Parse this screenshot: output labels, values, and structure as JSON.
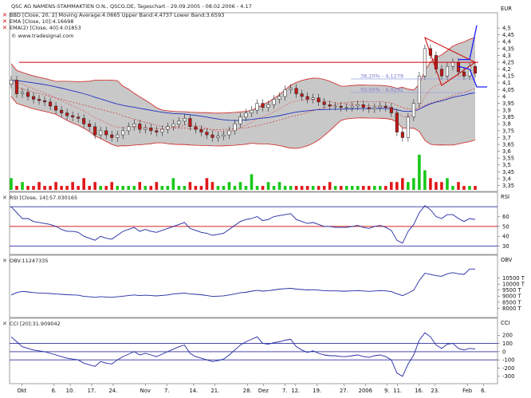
{
  "chart_data": {
    "type": "line",
    "header": "QSC AG NAMENS-STAMMAKTIEN O.N., QSCG.DE, Tageschart - 29.09.2005 - 08.02.2006 - 4.17",
    "currency": "EUR",
    "legend": [
      "BBD [Close, 20, 2] Moving Average:4.0665 Upper Band:4.4737 Lower Band:3.6593",
      "EMA [Close, 10]:4.16698",
      "EMA(2) [Close, 40]:4.01853"
    ],
    "source": "© www.tradesignal.com",
    "x_ticks": [
      "Okt",
      "6.",
      "10.",
      "17.",
      "24.",
      "Nov",
      "7.",
      "14.",
      "21.",
      "28.",
      "Dez",
      "7.",
      "12.",
      "19.",
      "27.",
      "2006",
      "9.",
      "11.",
      "16.",
      "23.",
      "Feb",
      "6."
    ],
    "price_ticks": [
      "4,5",
      "4,45",
      "4,4",
      "4,35",
      "4,3",
      "4,25",
      "4,2",
      "4,15",
      "4,1",
      "4,05",
      "4",
      "3,95",
      "3,9",
      "3,85",
      "3,8",
      "3,75",
      "3,7",
      "3,65",
      "3,6",
      "3,55",
      "3,5",
      "3,45",
      "3,4",
      "3,35"
    ],
    "ylim": [
      3.33,
      4.53
    ],
    "close": [
      4.12,
      4.02,
      4.03,
      4.0,
      3.98,
      3.97,
      3.96,
      3.93,
      3.9,
      3.88,
      3.86,
      3.85,
      3.84,
      3.8,
      3.78,
      3.72,
      3.75,
      3.72,
      3.7,
      3.72,
      3.75,
      3.78,
      3.8,
      3.76,
      3.77,
      3.75,
      3.74,
      3.76,
      3.78,
      3.8,
      3.82,
      3.84,
      3.78,
      3.76,
      3.74,
      3.72,
      3.7,
      3.71,
      3.72,
      3.75,
      3.8,
      3.85,
      3.88,
      3.9,
      3.95,
      3.92,
      3.94,
      3.98,
      4.0,
      4.05,
      4.06,
      4.02,
      4.0,
      3.98,
      3.99,
      3.96,
      3.94,
      3.93,
      3.93,
      3.92,
      3.92,
      3.93,
      3.94,
      3.92,
      3.91,
      3.92,
      3.93,
      3.92,
      3.88,
      3.74,
      3.7,
      3.85,
      3.95,
      4.15,
      4.35,
      4.3,
      4.2,
      4.15,
      4.22,
      4.25,
      4.18,
      4.15,
      4.22,
      4.17
    ],
    "volume": [
      3,
      1,
      2,
      1,
      1,
      2,
      1,
      1,
      2,
      1,
      1,
      2,
      1,
      3,
      1,
      2,
      1,
      1,
      2,
      1,
      1,
      1,
      1,
      2,
      1,
      1,
      2,
      1,
      1,
      3,
      1,
      1,
      2,
      1,
      1,
      3,
      2,
      1,
      1,
      2,
      1,
      2,
      1,
      4,
      1,
      1,
      2,
      1,
      2,
      1,
      1,
      1,
      1,
      1,
      1,
      1,
      1,
      2,
      1,
      1,
      1,
      1,
      1,
      1,
      1,
      1,
      1,
      1,
      2,
      2,
      3,
      2,
      3,
      9,
      5,
      3,
      2,
      2,
      3,
      1,
      2,
      1,
      1,
      1
    ],
    "horizontal_line": 4.25,
    "fibonacci": [
      {
        "label": "38,20% - 4,1279",
        "value": 4.1279
      },
      {
        "label": "50,00% - 4,0292",
        "value": 4.0292
      }
    ],
    "rsi": {
      "label": "RSI [Close, 14]:57.030165",
      "ticks": [
        "60",
        "50",
        "40",
        "30"
      ],
      "ylim": [
        24,
        75
      ],
      "levels": [
        30,
        50,
        70
      ],
      "values": [
        70,
        64,
        58,
        58,
        55,
        54,
        53,
        52,
        50,
        47,
        45,
        45,
        44,
        40,
        38,
        36,
        40,
        38,
        37,
        41,
        45,
        47,
        49,
        45,
        47,
        45,
        44,
        46,
        48,
        50,
        52,
        54,
        48,
        46,
        44,
        43,
        41,
        42,
        43,
        47,
        51,
        55,
        57,
        58,
        60,
        56,
        57,
        60,
        61,
        62,
        63,
        57,
        55,
        53,
        54,
        52,
        50,
        50,
        49,
        49,
        49,
        50,
        51,
        49,
        48,
        50,
        51,
        49,
        46,
        36,
        33,
        45,
        52,
        64,
        71,
        67,
        60,
        58,
        62,
        62,
        58,
        55,
        58,
        57
      ]
    },
    "obv": {
      "label": "OBV:11247335",
      "ticks": [
        "10500 T",
        "10000 T",
        "9500 T",
        "9000 T",
        "8500 T",
        "8000 T"
      ],
      "ylim": [
        7500,
        11600
      ],
      "values": [
        9100,
        9300,
        9400,
        9350,
        9300,
        9260,
        9240,
        9220,
        9180,
        9150,
        9120,
        9100,
        9080,
        8980,
        8950,
        8900,
        8960,
        8930,
        8900,
        8950,
        9000,
        9050,
        9100,
        9050,
        9080,
        9050,
        9020,
        9060,
        9100,
        9180,
        9220,
        9260,
        9180,
        9150,
        9120,
        9050,
        8980,
        9000,
        9030,
        9100,
        9180,
        9280,
        9320,
        9420,
        9480,
        9420,
        9460,
        9520,
        9580,
        9620,
        9650,
        9580,
        9550,
        9520,
        9540,
        9500,
        9460,
        9440,
        9440,
        9420,
        9420,
        9440,
        9460,
        9430,
        9400,
        9430,
        9460,
        9440,
        9380,
        9200,
        9050,
        9250,
        9500,
        10300,
        10900,
        10800,
        10700,
        10650,
        10850,
        10950,
        10850,
        10800,
        11250,
        11247
      ]
    },
    "cci": {
      "label": "CCI [20]:31.909042",
      "ticks": [
        "200",
        "100",
        "0",
        "-100",
        "-200",
        "-300"
      ],
      "ylim": [
        -360,
        290
      ],
      "levels": [
        100,
        0,
        -100
      ],
      "values": [
        180,
        120,
        60,
        40,
        20,
        10,
        0,
        -20,
        -40,
        -60,
        -80,
        -90,
        -100,
        -140,
        -160,
        -180,
        -120,
        -140,
        -150,
        -100,
        -60,
        -30,
        0,
        -40,
        -20,
        -40,
        -60,
        -30,
        0,
        30,
        60,
        80,
        -20,
        -60,
        -80,
        -100,
        -120,
        -110,
        -90,
        -40,
        20,
        80,
        120,
        150,
        180,
        100,
        90,
        110,
        120,
        140,
        150,
        60,
        20,
        -10,
        10,
        -20,
        -40,
        -50,
        -50,
        -60,
        -60,
        -50,
        -40,
        -60,
        -70,
        -50,
        -40,
        -60,
        -100,
        -260,
        -300,
        -150,
        -40,
        140,
        230,
        180,
        80,
        40,
        90,
        100,
        40,
        20,
        40,
        32
      ]
    }
  }
}
